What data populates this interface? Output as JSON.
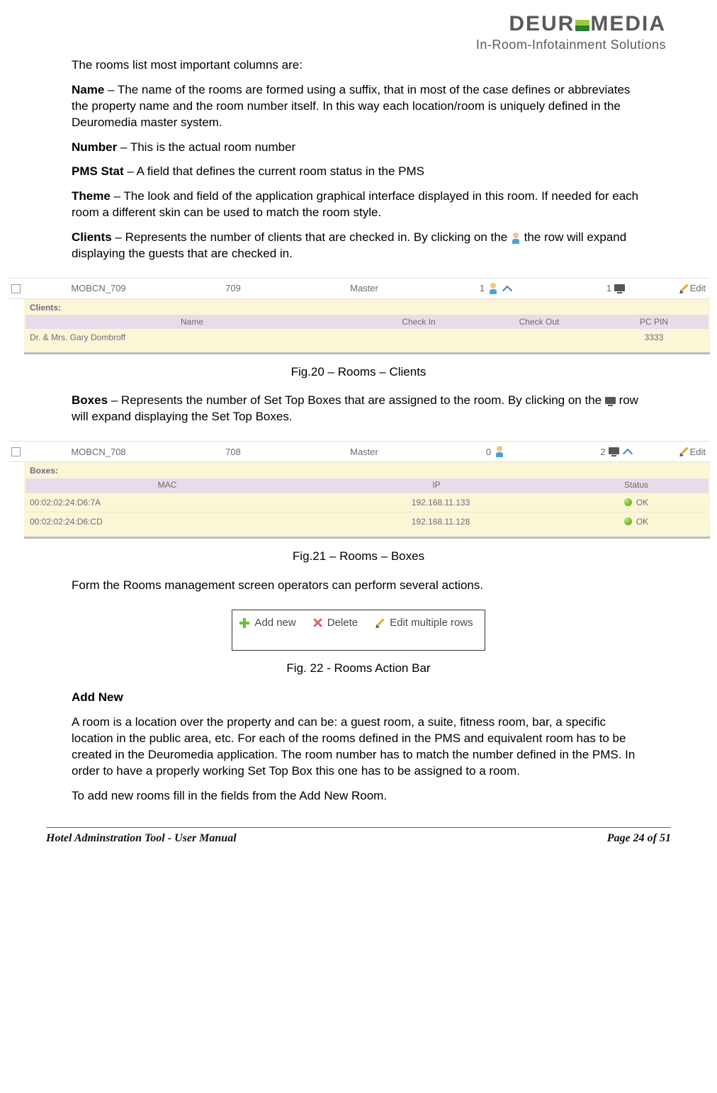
{
  "brand": {
    "name_left": "DEUR",
    "name_right": "MEDIA",
    "subtitle": "In-Room-Infotainment Solutions"
  },
  "intro": "The rooms list most important columns are:",
  "defs": {
    "name_label": "Name",
    "name_text": " – The name of the rooms are formed using a suffix, that in most of the case defines or abbreviates the property name and the room number itself. In this way each location/room is uniquely defined in the Deuromedia master system.",
    "number_label": "Number",
    "number_text": " – This is the actual room number",
    "pms_label": "PMS Stat",
    "pms_text": " – A field that defines the current room status in the PMS",
    "theme_label": "Theme",
    "theme_text": " – The look and field of the application graphical interface displayed in this room. If needed for each room a different skin can be used to match the room style.",
    "clients_label": "Clients",
    "clients_text_a": " – Represents the number of clients that are checked in. By clicking on the ",
    "clients_text_b": " the row will expand displaying the guests that are checked in.",
    "boxes_label": "Boxes",
    "boxes_text_a": " – Represents the number of Set Top Boxes that are assigned to the room. By clicking on the ",
    "boxes_text_b": " row will expand displaying the Set Top Boxes."
  },
  "fig20": {
    "row": {
      "name": "MOBCN_709",
      "num": "709",
      "theme": "Master",
      "clients": "1",
      "boxes": "1",
      "edit": "Edit"
    },
    "panel_label": "Clients:",
    "headers": {
      "c1": "Name",
      "c2": "Check In",
      "c3": "Check Out",
      "c4": "PC PIN"
    },
    "data": {
      "c1": "Dr. & Mrs. Gary Dombroff",
      "c2": "",
      "c3": "",
      "c4": "3333"
    },
    "caption": "Fig.20 – Rooms – Clients"
  },
  "fig21": {
    "row": {
      "name": "MOBCN_708",
      "num": "708",
      "theme": "Master",
      "clients": "0",
      "boxes": "2",
      "edit": "Edit"
    },
    "panel_label": "Boxes:",
    "headers": {
      "b1": "MAC",
      "b2": "IP",
      "b3": "Status"
    },
    "rows": [
      {
        "mac": "00:02:02:24:D6:7A",
        "ip": "192.168.11.133",
        "status": "OK"
      },
      {
        "mac": "00:02:02:24:D6:CD",
        "ip": "192.168.11.128",
        "status": "OK"
      }
    ],
    "caption": "Fig.21 – Rooms – Boxes"
  },
  "actions_intro": "Form the Rooms management screen operators can perform several actions.",
  "action_bar": {
    "add": "Add new",
    "delete": "Delete",
    "edit": "Edit multiple rows"
  },
  "fig22_caption": "Fig. 22 - Rooms Action Bar",
  "addnew": {
    "heading": "Add New",
    "p1": "A room is a location over the property and can be: a guest room, a suite, fitness room, bar, a specific location in the public area, etc. For each of the rooms defined in the PMS and equivalent room has to be created in the Deuromedia application. The room number has to match the number defined in the PMS. In order to have a properly working Set Top Box this one has to be assigned to a room.",
    "p2": "To add new rooms fill in the fields from the Add New Room."
  },
  "footer": {
    "left": "Hotel Adminstration Tool - User Manual",
    "right": "Page 24 of 51"
  }
}
